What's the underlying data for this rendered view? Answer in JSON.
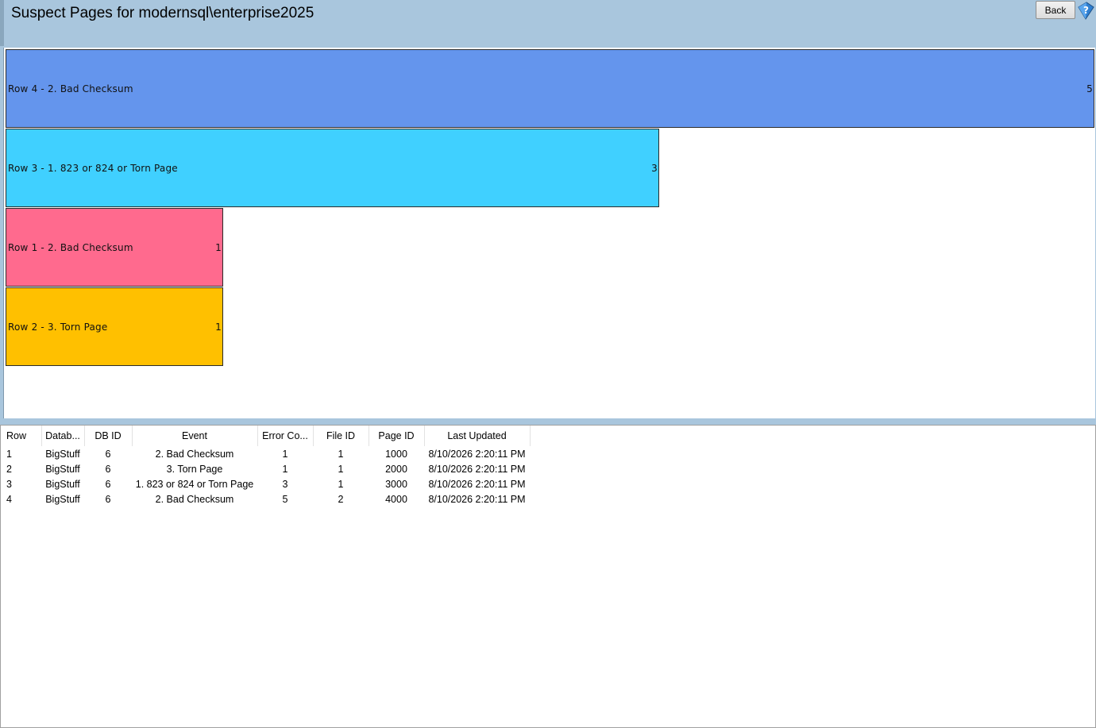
{
  "header": {
    "title": "Suspect Pages for modernsql\\enterprise2025",
    "back_label": "Back"
  },
  "chart_data": {
    "type": "bar",
    "orientation": "horizontal",
    "categories": [
      "Row 4 - 2. Bad Checksum",
      "Row 3 - 1. 823 or 824 or Torn Page",
      "Row 1 - 2. Bad Checksum",
      "Row 2 - 3. Torn Page"
    ],
    "values": [
      5,
      3,
      1,
      1
    ],
    "xlim": [
      0,
      5
    ],
    "colors": [
      "#6495ed",
      "#40d0ff",
      "#ff6a8e",
      "#ffc000"
    ],
    "grid": false,
    "legend": "none"
  },
  "table": {
    "columns": [
      "Row",
      "Datab...",
      "DB ID",
      "Event",
      "Error Co...",
      "File ID",
      "Page ID",
      "Last Updated"
    ],
    "rows": [
      [
        "1",
        "BigStuff",
        "6",
        "2. Bad Checksum",
        "1",
        "1",
        "1000",
        "8/10/2026 2:20:11 PM"
      ],
      [
        "2",
        "BigStuff",
        "6",
        "3. Torn Page",
        "1",
        "1",
        "2000",
        "8/10/2026 2:20:11 PM"
      ],
      [
        "3",
        "BigStuff",
        "6",
        "1. 823 or 824 or Torn Page",
        "3",
        "1",
        "3000",
        "8/10/2026 2:20:11 PM"
      ],
      [
        "4",
        "BigStuff",
        "6",
        "2. Bad Checksum",
        "5",
        "2",
        "4000",
        "8/10/2026 2:20:11 PM"
      ]
    ]
  },
  "icons": {
    "help": "help-question-icon"
  }
}
